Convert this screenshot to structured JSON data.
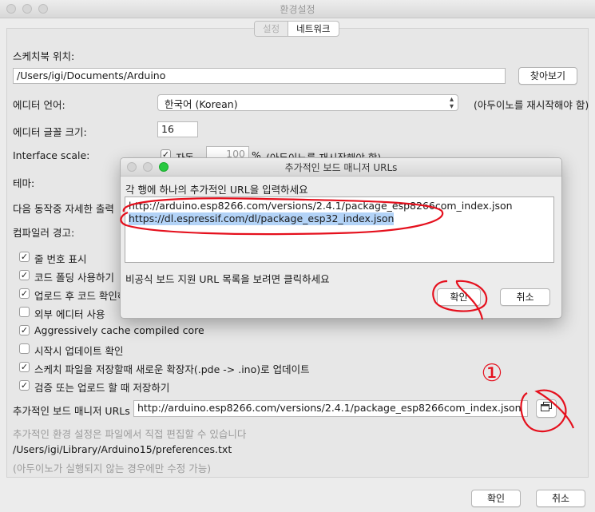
{
  "window": {
    "title": "환경설정"
  },
  "tabs": [
    {
      "label": "설정"
    },
    {
      "label": "네트워크"
    }
  ],
  "settings": {
    "sketchbook_label": "스케치북 위치:",
    "sketchbook_value": "/Users/igi/Documents/Arduino",
    "browse_label": "찾아보기",
    "editor_language_label": "에디터 언어:",
    "editor_language_value": "한국어 (Korean)",
    "editor_language_note": "(아두이노를 재시작해야 함)",
    "font_size_label": "에디터 글꼴 크기:",
    "font_size_value": "16",
    "interface_scale_label": "Interface scale:",
    "interface_auto_label": "자동",
    "interface_scale_value": "100",
    "interface_scale_unit": "%",
    "interface_note": "(아두이노를 재시작해야 함)",
    "theme_label": "테마:",
    "verbose_label": "다음 동작중 자세한 출력",
    "compiler_warnings_label": "컴파일러 경고:",
    "checkboxes": [
      {
        "label": "줄 번호 표시",
        "checked": true
      },
      {
        "label": "코드 폴딩 사용하기",
        "checked": true
      },
      {
        "label": "업로드 후 코드 확인하",
        "checked": true
      },
      {
        "label": "외부 에디터 사용",
        "checked": false
      },
      {
        "label": "Aggressively cache compiled core",
        "checked": true
      },
      {
        "label": "시작시 업데이트 확인",
        "checked": false
      },
      {
        "label": "스케치 파일을 저장할때 새로운 확장자(.pde -> .ino)로 업데이트",
        "checked": true
      },
      {
        "label": "검증 또는 업로드 할 때 저장하기",
        "checked": true
      }
    ],
    "board_urls_label": "추가적인 보드 매니저 URLs",
    "board_urls_value": "http://arduino.esp8266.com/versions/2.4.1/package_esp8266com_index.json",
    "more_prefs_note": "추가적인 환경 설정은 파일에서 직접 편집할 수 있습니다",
    "prefs_path": "/Users/igi/Library/Arduino15/preferences.txt",
    "prefs_path_note": "(아두이노가 실행되지 않는 경우에만 수정 가능)"
  },
  "footer": {
    "ok_label": "확인",
    "cancel_label": "취소"
  },
  "dialog": {
    "title": "추가적인 보드 매니저 URLs",
    "instruction": "각 행에 하나의 추가적인 URL을 입력하세요",
    "lines": [
      "http://arduino.esp8266.com/versions/2.4.1/package_esp8266com_index.json",
      "https://dl.espressif.com/dl/package_esp32_index.json"
    ],
    "link_text": "비공식 보드 지원 URL 목록을 보려면 클릭하세요",
    "ok_label": "확인",
    "cancel_label": "취소"
  },
  "annotations": {
    "step_marker": "①"
  },
  "colors": {
    "selection": "#b3d3f7",
    "annotation_red": "#e5101d"
  },
  "icons": {
    "expand_button": "window-stack-icon",
    "select_arrows": "chevron-updown-icon",
    "check": "checkmark-icon"
  }
}
